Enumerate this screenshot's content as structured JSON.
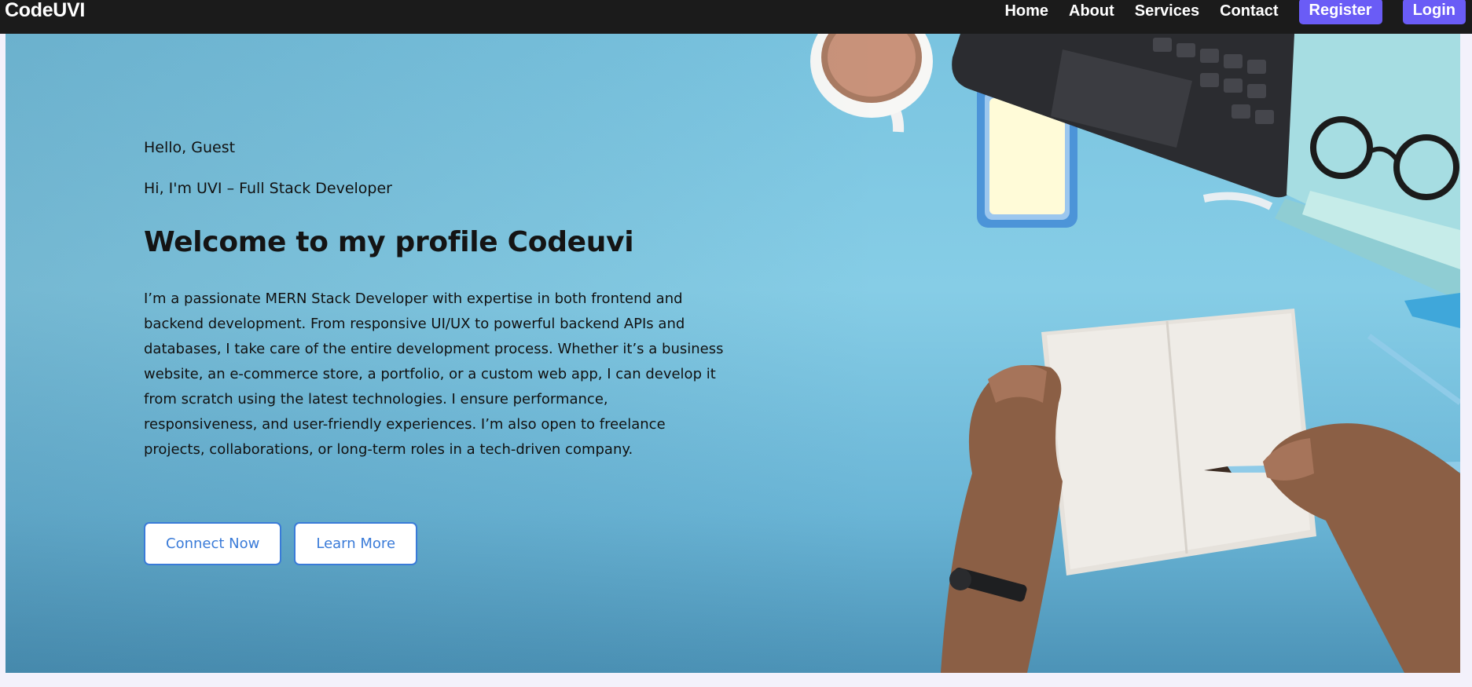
{
  "navbar": {
    "brand": "CodeUVI",
    "links": [
      "Home",
      "About",
      "Services",
      "Contact"
    ],
    "register_label": "Register",
    "login_label": "Login",
    "button_color": "#6a5cf6"
  },
  "hero": {
    "greeting": "Hello, Guest",
    "intro": "Hi, I'm UVI – Full Stack Developer",
    "headline": "Welcome to my profile Codeuvi",
    "bio": "I’m a passionate MERN Stack Developer with expertise in both frontend and backend development. From responsive UI/UX to powerful backend APIs and databases, I take care of the entire development process. Whether it’s a business website, an e-commerce store, a portfolio, or a custom web app, I can develop it from scratch using the latest technologies. I ensure performance, responsiveness, and user-friendly experiences. I’m also open to freelance projects, collaborations, or long-term roles in a tech-driven company.",
    "connect_label": "Connect Now",
    "learn_label": "Learn More",
    "accent_color": "#3a7bd8",
    "background_image": "desk-with-notebook-hands-pencil-coffee-laptop-glasses-photo"
  }
}
